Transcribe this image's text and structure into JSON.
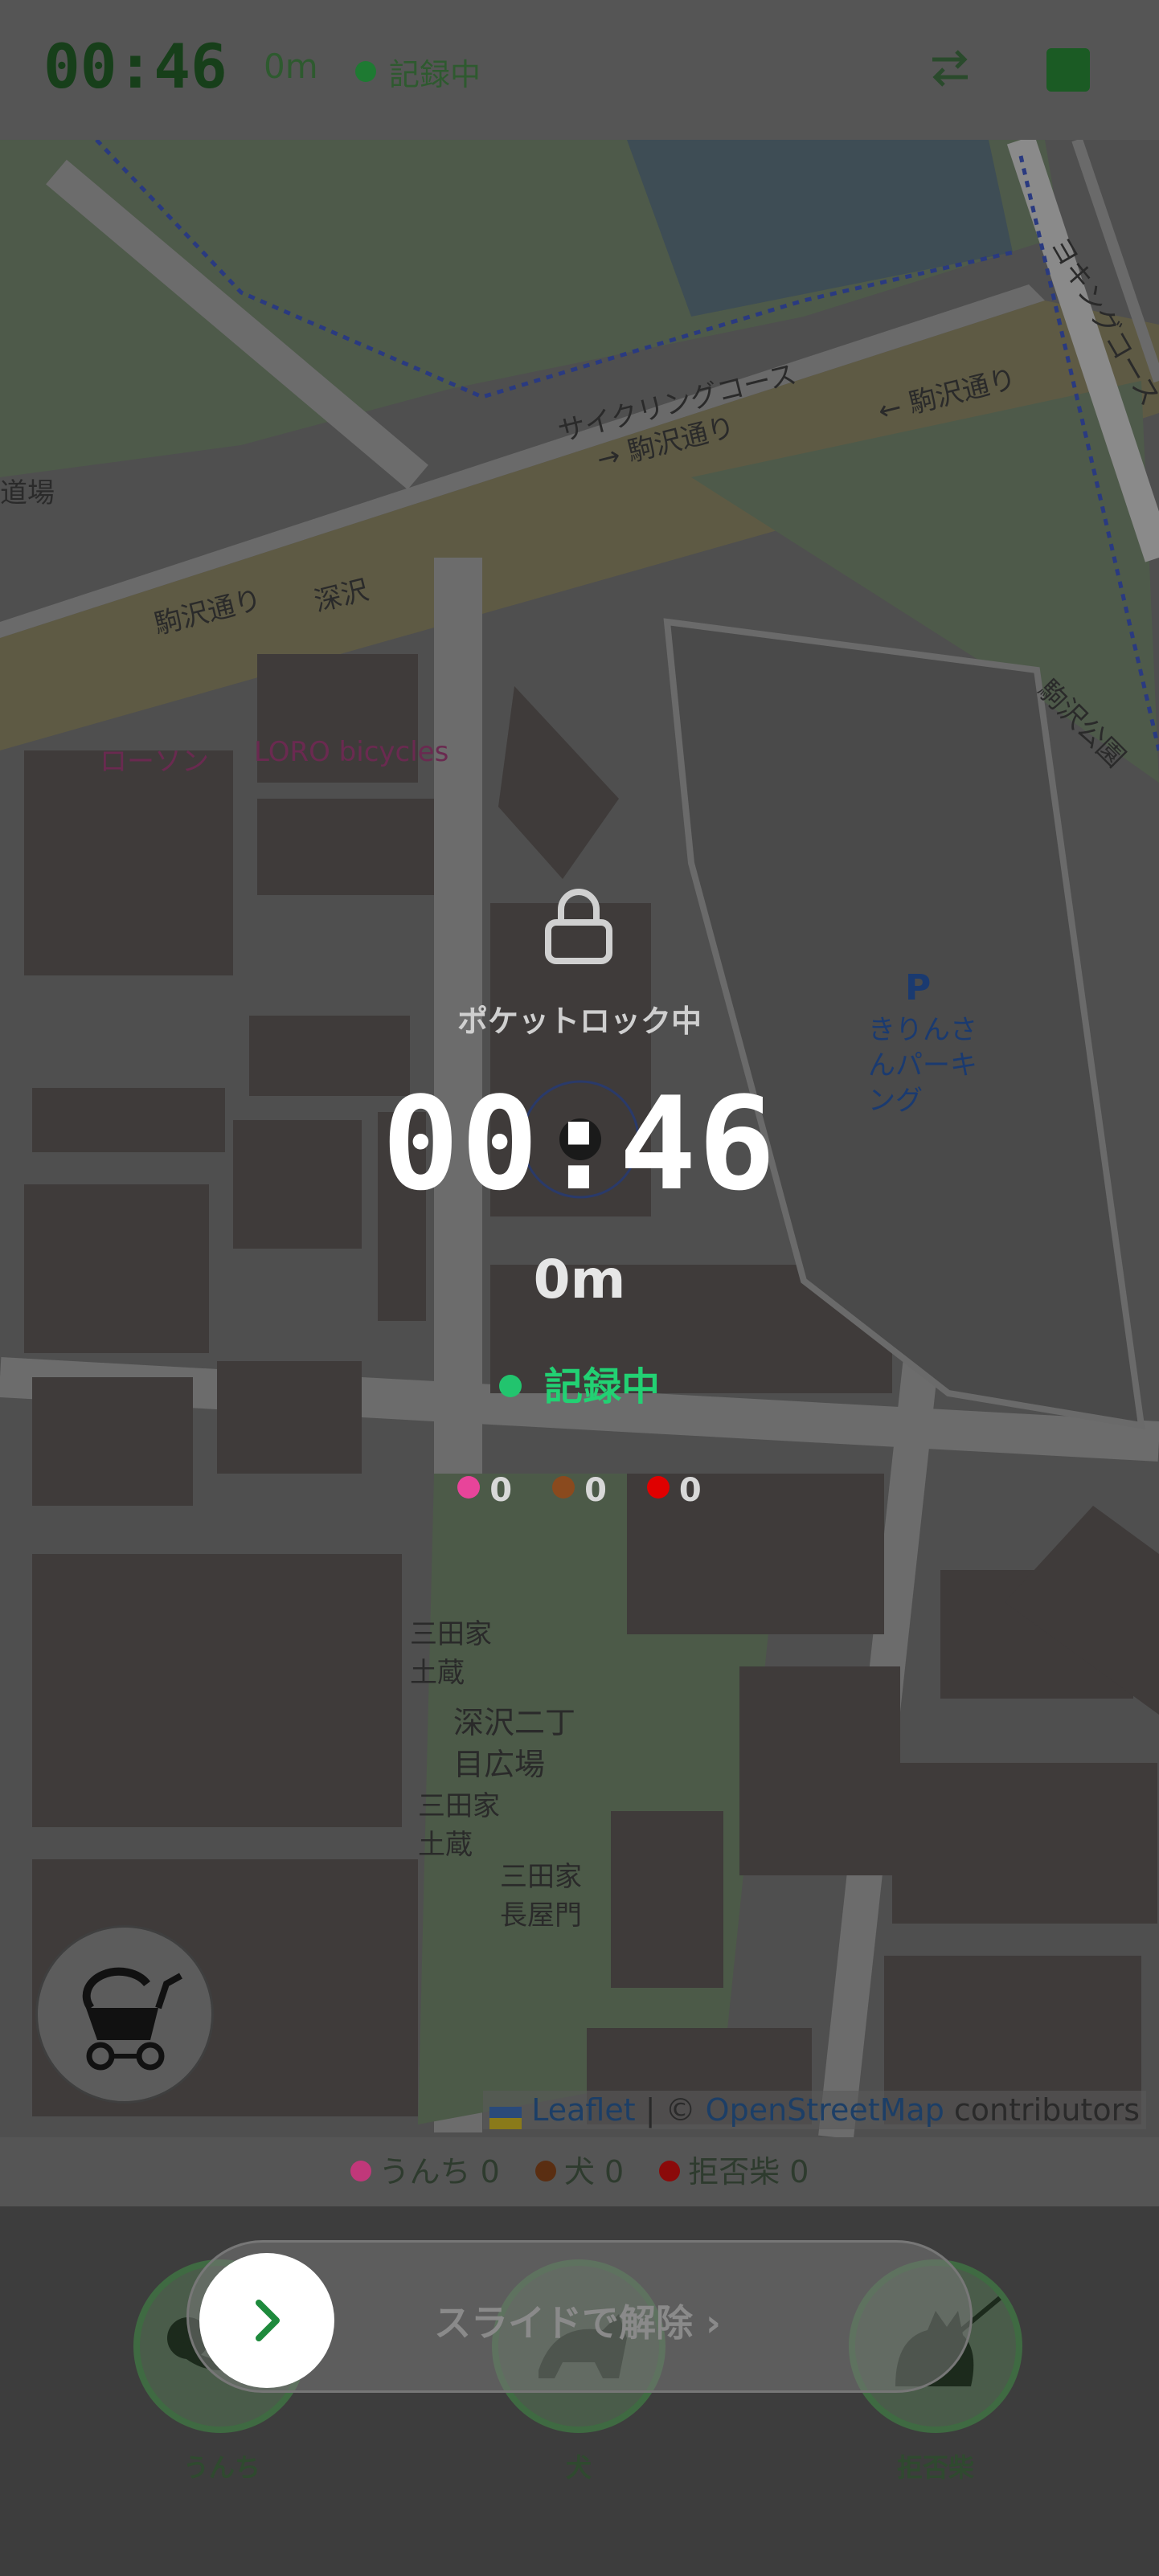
{
  "header": {
    "time": "00:46",
    "distance": "0m",
    "status": "記録中",
    "swap_icon": "swap-arrows-icon",
    "stop_icon": "stop-square-icon"
  },
  "map": {
    "labels": {
      "cycling_course": "サイクリングコース",
      "komazawa_1": "駒沢通り",
      "komazawa_2": "→ 駒沢通り",
      "komazawa_3": "← 駒沢通り",
      "fukasawa": "深沢",
      "lawson": "ローソン",
      "loro": "LORO bicycles",
      "parking_p": "P",
      "parking_name": "きりんさ\nんパーキ\nング",
      "sanda_1": "三田家\n土蔵",
      "fukasawa_park": "深沢二丁\n目広場",
      "sanda_2": "三田家\n土蔵",
      "sanda_3": "三田家\n長屋門",
      "komazawa_park": "駒沢公園",
      "yokinguro": "ヨキングコース",
      "michi": "道場"
    },
    "attribution": {
      "leaflet": "Leaflet",
      "sep": " | © ",
      "osm": "OpenStreetMap",
      "contributors": " contributors"
    }
  },
  "lock_overlay": {
    "lock_label": "ポケットロック中",
    "time": "00:46",
    "distance": "0m",
    "status": "記録中",
    "counts": [
      "0",
      "0",
      "0"
    ]
  },
  "legend": [
    {
      "label": "うんち 0",
      "color": "#c0387a"
    },
    {
      "label": "犬 0",
      "color": "#5a2e12"
    },
    {
      "label": "拒否柴 0",
      "color": "#8b0a0a"
    }
  ],
  "actions": [
    {
      "label": "うんち"
    },
    {
      "label": "犬"
    },
    {
      "label": "拒否柴"
    }
  ],
  "slider": {
    "text": "スライドで解除 ›"
  },
  "colors": {
    "accent_green": "#22d173",
    "pink": "#e8449a",
    "brown": "#8a4a1e",
    "red": "#e00000"
  }
}
